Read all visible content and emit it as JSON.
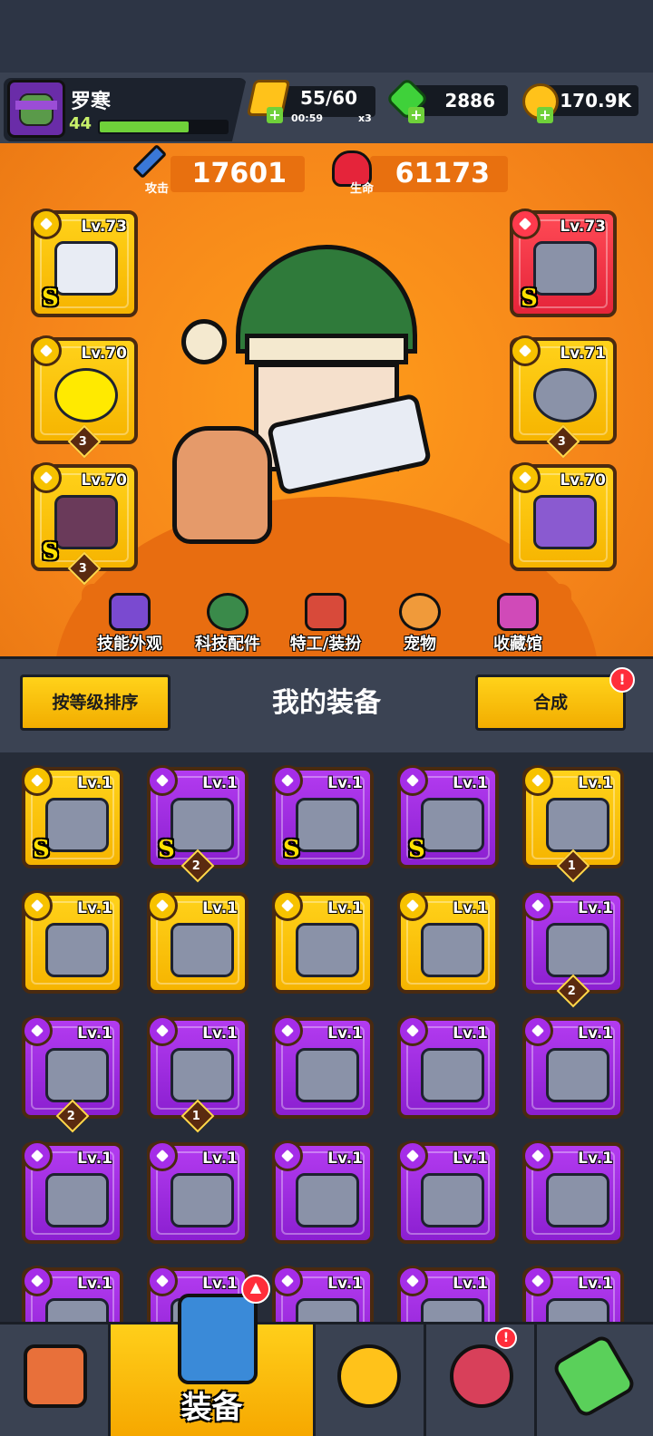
{
  "player": {
    "name": "罗寒",
    "level": "44",
    "xp_progress": 0.7
  },
  "resources": {
    "energy": {
      "value": "55/60",
      "timer": "00:59",
      "multiplier": "x3",
      "icon": "energy-icon"
    },
    "gems": {
      "value": "2886",
      "icon": "gem-icon"
    },
    "coins": {
      "value": "170.9K",
      "icon": "coin-icon"
    }
  },
  "stats": {
    "attack": {
      "label": "攻击",
      "value": "17601",
      "icon": "sword-icon"
    },
    "health": {
      "label": "生命",
      "value": "61173",
      "icon": "heart-icon"
    }
  },
  "equipped": {
    "left": [
      {
        "level": "Lv.73",
        "rank": "S",
        "count": "",
        "type": "weapon"
      },
      {
        "level": "Lv.70",
        "rank": "",
        "count": "3",
        "type": "necklace"
      },
      {
        "level": "Lv.70",
        "rank": "S",
        "count": "3",
        "type": "glove"
      }
    ],
    "right": [
      {
        "level": "Lv.73",
        "rank": "S",
        "count": "",
        "type": "armor"
      },
      {
        "level": "Lv.71",
        "rank": "",
        "count": "3",
        "type": "belt"
      },
      {
        "level": "Lv.70",
        "rank": "",
        "count": "",
        "type": "boots"
      }
    ]
  },
  "categories": [
    {
      "label": "技能外观"
    },
    {
      "label": "科技配件"
    },
    {
      "label": "特工/装扮"
    },
    {
      "label": "宠物"
    },
    {
      "label": "收藏馆"
    }
  ],
  "inventory_header": {
    "sort_label": "按等级排序",
    "title": "我的装备",
    "merge_label": "合成",
    "merge_alert": "!"
  },
  "inventory": [
    [
      {
        "level": "Lv.1",
        "rank": "S",
        "count": "",
        "rarity": "gold"
      },
      {
        "level": "Lv.1",
        "rank": "S",
        "count": "2",
        "rarity": "purple"
      },
      {
        "level": "Lv.1",
        "rank": "S",
        "count": "",
        "rarity": "purple"
      },
      {
        "level": "Lv.1",
        "rank": "S",
        "count": "",
        "rarity": "purple"
      },
      {
        "level": "Lv.1",
        "rank": "",
        "count": "1",
        "rarity": "gold"
      }
    ],
    [
      {
        "level": "Lv.1",
        "rank": "",
        "count": "",
        "rarity": "gold"
      },
      {
        "level": "Lv.1",
        "rank": "",
        "count": "",
        "rarity": "gold"
      },
      {
        "level": "Lv.1",
        "rank": "",
        "count": "",
        "rarity": "gold"
      },
      {
        "level": "Lv.1",
        "rank": "",
        "count": "",
        "rarity": "gold"
      },
      {
        "level": "Lv.1",
        "rank": "",
        "count": "2",
        "rarity": "purple"
      }
    ],
    [
      {
        "level": "Lv.1",
        "rank": "",
        "count": "2",
        "rarity": "purple"
      },
      {
        "level": "Lv.1",
        "rank": "",
        "count": "1",
        "rarity": "purple"
      },
      {
        "level": "Lv.1",
        "rank": "",
        "count": "",
        "rarity": "purple"
      },
      {
        "level": "Lv.1",
        "rank": "",
        "count": "",
        "rarity": "purple"
      },
      {
        "level": "Lv.1",
        "rank": "",
        "count": "",
        "rarity": "purple"
      }
    ],
    [
      {
        "level": "Lv.1",
        "rank": "",
        "count": "",
        "rarity": "purple"
      },
      {
        "level": "Lv.1",
        "rank": "",
        "count": "",
        "rarity": "purple"
      },
      {
        "level": "Lv.1",
        "rank": "",
        "count": "",
        "rarity": "purple"
      },
      {
        "level": "Lv.1",
        "rank": "",
        "count": "",
        "rarity": "purple"
      },
      {
        "level": "Lv.1",
        "rank": "",
        "count": "",
        "rarity": "purple"
      }
    ],
    [
      {
        "level": "Lv.1",
        "rank": "",
        "count": "",
        "rarity": "purple"
      },
      {
        "level": "Lv.1",
        "rank": "",
        "count": "",
        "rarity": "purple"
      },
      {
        "level": "Lv.1",
        "rank": "",
        "count": "",
        "rarity": "purple"
      },
      {
        "level": "Lv.1",
        "rank": "",
        "count": "",
        "rarity": "purple"
      },
      {
        "level": "Lv.1",
        "rank": "",
        "count": "",
        "rarity": "purple"
      }
    ]
  ],
  "nav": {
    "shop": {
      "icon": "shop-icon"
    },
    "equipment": {
      "label": "装备",
      "icon": "equipment-icon"
    },
    "battle": {
      "icon": "star-swords-icon"
    },
    "planet": {
      "icon": "planet-icon",
      "alert": "!"
    },
    "lab": {
      "icon": "dna-icon"
    }
  },
  "colors": {
    "gold": "#f6b400",
    "purple": "#8b1fd0",
    "red": "#e5243a",
    "accent": "#f5841a"
  }
}
